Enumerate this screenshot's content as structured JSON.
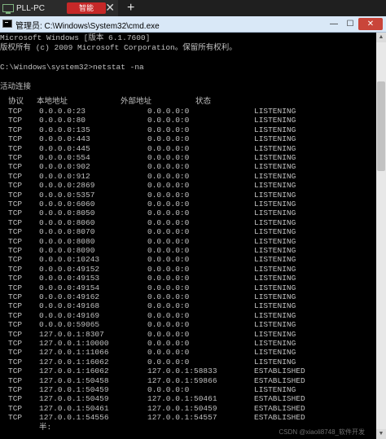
{
  "tab": {
    "label": "PLL-PC",
    "badge": "智能",
    "close": "✕",
    "new_tab": "+"
  },
  "window": {
    "title": "管理员: C:\\Windows\\System32\\cmd.exe",
    "min": "—",
    "max": "☐",
    "close": "✕"
  },
  "console": {
    "header_1": "Microsoft Windows [版本 6.1.7600]",
    "header_2": "版权所有 (c) 2009 Microsoft Corporation。保留所有权利。",
    "prompt": "C:\\Windows\\system32>netstat -na",
    "section": "活动连接",
    "columns": [
      "协议",
      "本地地址",
      "外部地址",
      "状态"
    ],
    "rows": [
      [
        "TCP",
        "0.0.0.0:23",
        "0.0.0.0:0",
        "LISTENING"
      ],
      [
        "TCP",
        "0.0.0.0:80",
        "0.0.0.0:0",
        "LISTENING"
      ],
      [
        "TCP",
        "0.0.0.0:135",
        "0.0.0.0:0",
        "LISTENING"
      ],
      [
        "TCP",
        "0.0.0.0:443",
        "0.0.0.0:0",
        "LISTENING"
      ],
      [
        "TCP",
        "0.0.0.0:445",
        "0.0.0.0:0",
        "LISTENING"
      ],
      [
        "TCP",
        "0.0.0.0:554",
        "0.0.0.0:0",
        "LISTENING"
      ],
      [
        "TCP",
        "0.0.0.0:902",
        "0.0.0.0:0",
        "LISTENING"
      ],
      [
        "TCP",
        "0.0.0.0:912",
        "0.0.0.0:0",
        "LISTENING"
      ],
      [
        "TCP",
        "0.0.0.0:2869",
        "0.0.0.0:0",
        "LISTENING"
      ],
      [
        "TCP",
        "0.0.0.0:5357",
        "0.0.0.0:0",
        "LISTENING"
      ],
      [
        "TCP",
        "0.0.0.0:6060",
        "0.0.0.0:0",
        "LISTENING"
      ],
      [
        "TCP",
        "0.0.0.0:8050",
        "0.0.0.0:0",
        "LISTENING"
      ],
      [
        "TCP",
        "0.0.0.0:8060",
        "0.0.0.0:0",
        "LISTENING"
      ],
      [
        "TCP",
        "0.0.0.0:8070",
        "0.0.0.0:0",
        "LISTENING"
      ],
      [
        "TCP",
        "0.0.0.0:8080",
        "0.0.0.0:0",
        "LISTENING"
      ],
      [
        "TCP",
        "0.0.0.0:8090",
        "0.0.0.0:0",
        "LISTENING"
      ],
      [
        "TCP",
        "0.0.0.0:10243",
        "0.0.0.0:0",
        "LISTENING"
      ],
      [
        "TCP",
        "0.0.0.0:49152",
        "0.0.0.0:0",
        "LISTENING"
      ],
      [
        "TCP",
        "0.0.0.0:49153",
        "0.0.0.0:0",
        "LISTENING"
      ],
      [
        "TCP",
        "0.0.0.0:49154",
        "0.0.0.0:0",
        "LISTENING"
      ],
      [
        "TCP",
        "0.0.0.0:49162",
        "0.0.0.0:0",
        "LISTENING"
      ],
      [
        "TCP",
        "0.0.0.0:49168",
        "0.0.0.0:0",
        "LISTENING"
      ],
      [
        "TCP",
        "0.0.0.0:49169",
        "0.0.0.0:0",
        "LISTENING"
      ],
      [
        "TCP",
        "0.0.0.0:59065",
        "0.0.0.0:0",
        "LISTENING"
      ],
      [
        "TCP",
        "127.0.0.1:8307",
        "0.0.0.0:0",
        "LISTENING"
      ],
      [
        "TCP",
        "127.0.0.1:10000",
        "0.0.0.0:0",
        "LISTENING"
      ],
      [
        "TCP",
        "127.0.0.1:11066",
        "0.0.0.0:0",
        "LISTENING"
      ],
      [
        "TCP",
        "127.0.0.1:16062",
        "0.0.0.0:0",
        "LISTENING"
      ],
      [
        "TCP",
        "127.0.0.1:16062",
        "127.0.0.1:58833",
        "ESTABLISHED"
      ],
      [
        "TCP",
        "127.0.0.1:50458",
        "127.0.0.1:59866",
        "ESTABLISHED"
      ],
      [
        "TCP",
        "127.0.0.1:50459",
        "0.0.0.0:0",
        "LISTENING"
      ],
      [
        "TCP",
        "127.0.0.1:50459",
        "127.0.0.1:50461",
        "ESTABLISHED"
      ],
      [
        "TCP",
        "127.0.0.1:50461",
        "127.0.0.1:50459",
        "ESTABLISHED"
      ],
      [
        "TCP",
        "127.0.0.1:54556",
        "127.0.0.1:54557",
        "ESTABLISHED"
      ]
    ],
    "last_line": "半:",
    "watermark": "CSDN @xiaoli8748_软件开发"
  },
  "colors": {
    "console_bg": "#000000",
    "console_fg": "#c0c0c0",
    "titlebar": "#d9e8f7",
    "tabbar": "#1f1f1f",
    "badge": "#c62828",
    "close_btn": "#c9453a"
  }
}
